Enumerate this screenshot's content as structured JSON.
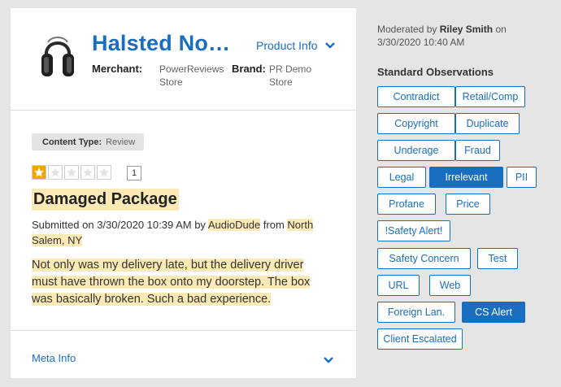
{
  "product": {
    "title": "Halsted No…",
    "info_button": "Product Info",
    "merchant_label": "Merchant:",
    "merchant_value_line1": "PowerReviews",
    "merchant_value_line2": "Store",
    "brand_label": "Brand:",
    "brand_value_line1": "PR Demo",
    "brand_value_line2": "Store"
  },
  "review": {
    "content_type_label": "Content Type:",
    "content_type_value": "Review",
    "rating": 1,
    "rating_max": 5,
    "rating_count": "1",
    "title": "Damaged Package",
    "submitted_prefix": "Submitted on 3/30/2020 10:39 AM by",
    "author": "AudioDude",
    "from_text": "from",
    "location": "North Salem, NY",
    "body": "Not only was my delivery late, but the delivery driver must have thrown the box onto my doorstep. The box was basically broken. Such a bad experience."
  },
  "meta_info": {
    "label": "Meta Info"
  },
  "moderation": {
    "moderated_prefix": "Moderated by",
    "moderator": "Riley Smith",
    "moderated_suffix": "on",
    "moderated_date": "3/30/2020 10:40 AM",
    "standard_observations_title": "Standard Observations",
    "observations": [
      {
        "label": "Contradict",
        "active": false
      },
      {
        "label": "Retail/Comp",
        "active": false
      },
      {
        "label": "Copyright",
        "active": false
      },
      {
        "label": "Duplicate",
        "active": false
      },
      {
        "label": "Underage",
        "active": false
      },
      {
        "label": "Fraud",
        "active": false
      },
      {
        "label": "Legal",
        "active": false
      },
      {
        "label": "Irrelevant",
        "active": true
      },
      {
        "label": "PII",
        "active": false
      },
      {
        "label": "Profane",
        "active": false
      },
      {
        "label": "Price",
        "active": false
      },
      {
        "label": "!Safety Alert!",
        "active": false
      },
      {
        "label": "Safety Concern",
        "active": false
      },
      {
        "label": "Test",
        "active": false
      },
      {
        "label": "URL",
        "active": false
      },
      {
        "label": "Web",
        "active": false
      },
      {
        "label": "Foreign Lan.",
        "active": false
      },
      {
        "label": "CS Alert",
        "active": true
      },
      {
        "label": "Client Escalated",
        "active": false
      }
    ]
  },
  "colors": {
    "accent": "#1a6ec0",
    "highlight": "#fbe9b6",
    "star": "#f0a500"
  },
  "icons": {
    "product": "headphones-image",
    "chevron": "chevron-down-icon",
    "star": "star-icon"
  }
}
